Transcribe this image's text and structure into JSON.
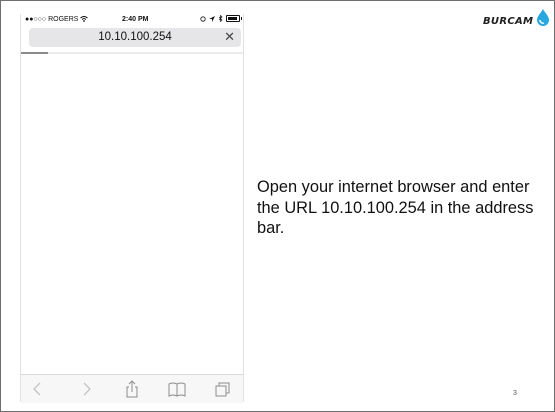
{
  "status_bar": {
    "signal": "●●○○○",
    "carrier": "ROGERS",
    "time": "2:40 PM"
  },
  "address_bar": {
    "url": "10.10.100.254",
    "close_glyph": "✕"
  },
  "page_load_progress": 0.12,
  "toolbar_icons": [
    "back-icon",
    "forward-icon",
    "share-icon",
    "bookmarks-icon",
    "tabs-icon"
  ],
  "logo": {
    "text": "BURCAM"
  },
  "instruction": "Open your internet browser and enter the URL 10.10.100.254 in the address bar.",
  "page_number": "3",
  "colors": {
    "accent_blue": "#29a8e0",
    "address_bar_bg": "#e6e6e8"
  }
}
